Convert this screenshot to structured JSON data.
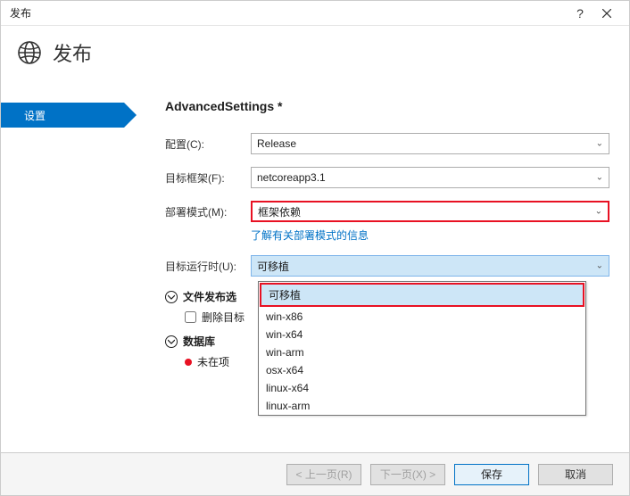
{
  "titlebar": {
    "title": "发布",
    "help": "?"
  },
  "header": {
    "title": "发布"
  },
  "sidebar": {
    "tab": "设置"
  },
  "main": {
    "section_title": "AdvancedSettings *",
    "config": {
      "label": "配置(C):",
      "value": "Release"
    },
    "framework": {
      "label": "目标框架(F):",
      "value": "netcoreapp3.1"
    },
    "deploy_mode": {
      "label": "部署模式(M):",
      "value": "框架依赖"
    },
    "deploy_info_link": "了解有关部署模式的信息",
    "runtime": {
      "label": "目标运行时(U):",
      "value": "可移植"
    },
    "group_publish": {
      "title": "文件发布选",
      "checkbox": "删除目标"
    },
    "group_db": {
      "title": "数据库",
      "note": "未在项"
    }
  },
  "dropdown": {
    "options": [
      "可移植",
      "win-x86",
      "win-x64",
      "win-arm",
      "osx-x64",
      "linux-x64",
      "linux-arm"
    ]
  },
  "footer": {
    "prev": "< 上一页(R)",
    "next": "下一页(X) >",
    "save": "保存",
    "cancel": "取消"
  }
}
